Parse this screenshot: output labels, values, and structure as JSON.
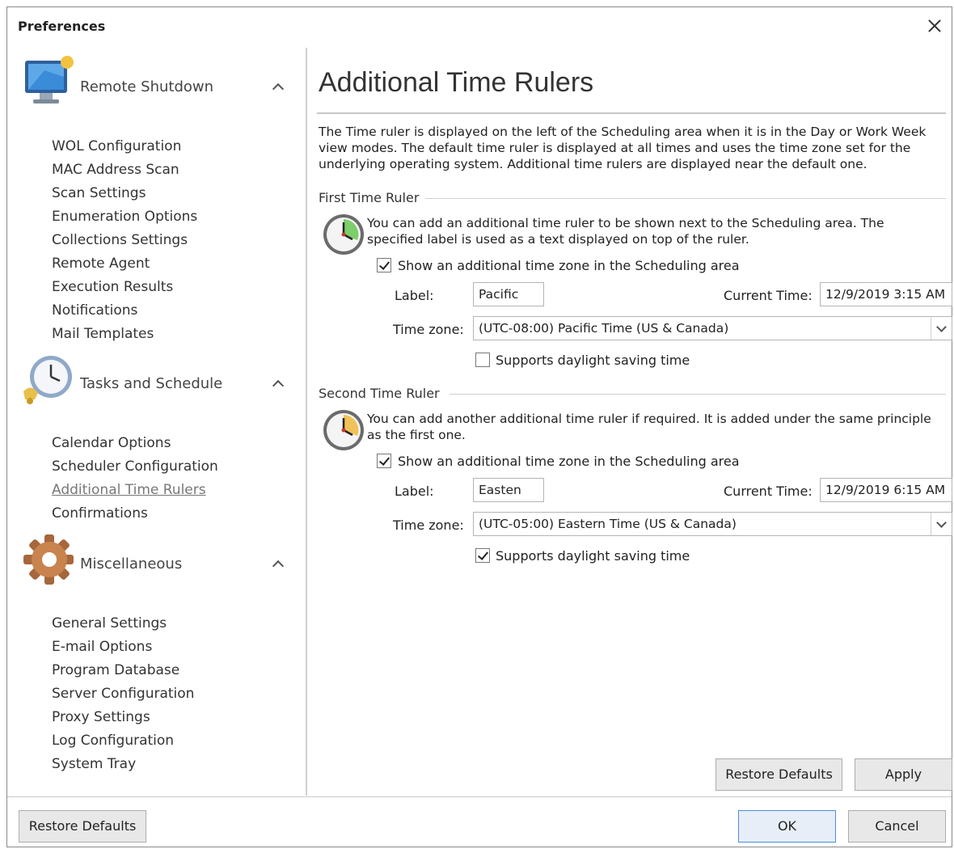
{
  "window": {
    "title": "Preferences"
  },
  "sidebar": {
    "groups": [
      {
        "label": "Remote Shutdown",
        "icon": "monitor-icon",
        "items": [
          "WOL Configuration",
          "MAC Address Scan",
          "Scan Settings",
          "Enumeration Options",
          "Collections Settings",
          "Remote Agent",
          "Execution Results",
          "Notifications",
          "Mail Templates"
        ]
      },
      {
        "label": "Tasks and Schedule",
        "icon": "alarm-clock-icon",
        "items": [
          "Calendar Options",
          "Scheduler Configuration",
          "Additional Time Rulers",
          "Confirmations"
        ],
        "active_item": "Additional Time Rulers"
      },
      {
        "label": "Miscellaneous",
        "icon": "gear-icon",
        "items": [
          "General Settings",
          "E-mail Options",
          "Program Database",
          "Server Configuration",
          "Proxy Settings",
          "Log Configuration",
          "System Tray"
        ]
      }
    ]
  },
  "main": {
    "title": "Additional Time Rulers",
    "description": "The Time ruler is displayed on the left of the Scheduling area when it is in the Day or Work Week view modes. The default time ruler is displayed at all times and uses the time zone set for the underlying operating system. Additional time rulers are displayed near the default one.",
    "first": {
      "heading": "First Time Ruler",
      "text": "You can add an additional time ruler to be shown next to the Scheduling area. The specified label is used as a text displayed on top of the ruler.",
      "show_label": "Show an additional time zone in the Scheduling area",
      "show_checked": true,
      "label_caption": "Label:",
      "label_value": "Pacific",
      "current_time_caption": "Current Time:",
      "current_time": "12/9/2019 3:15 AM",
      "timezone_caption": "Time zone:",
      "timezone": "(UTC-08:00) Pacific Time (US & Canada)",
      "dst_label": "Supports daylight saving time",
      "dst_checked": false
    },
    "second": {
      "heading": "Second Time Ruler",
      "text": "You can add another additional time ruler if required. It is added under the same principle as the first one.",
      "show_label": "Show an additional time zone in the Scheduling area",
      "show_checked": true,
      "label_caption": "Label:",
      "label_value": "Easten",
      "current_time_caption": "Current Time:",
      "current_time": "12/9/2019 6:15 AM",
      "timezone_caption": "Time zone:",
      "timezone": "(UTC-05:00) Eastern Time (US & Canada)",
      "dst_label": "Supports daylight saving time",
      "dst_checked": true
    },
    "restore_label": "Restore Defaults",
    "apply_label": "Apply"
  },
  "footer": {
    "restore_label": "Restore Defaults",
    "ok_label": "OK",
    "cancel_label": "Cancel"
  }
}
